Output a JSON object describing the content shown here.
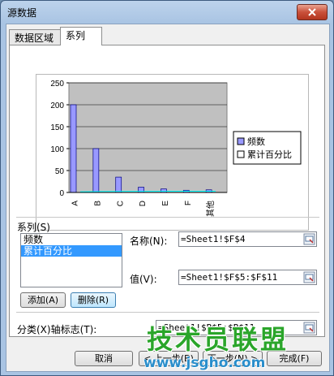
{
  "window": {
    "title": "源数据"
  },
  "tabs": [
    {
      "label": "数据区域"
    },
    {
      "label": "系列"
    }
  ],
  "series_section": {
    "label": "系列(S)",
    "items": [
      "频数",
      "累计百分比"
    ],
    "selected_index": 1,
    "add_button": "添加(A)",
    "delete_button": "删除(R)"
  },
  "fields": {
    "name_label": "名称(N):",
    "name_value": "=Sheet1!$F$4",
    "value_label": "值(V):",
    "value_value": "=Sheet1!$F$5:$F$11",
    "category_label": "分类(X)轴标志(T):",
    "category_value": "=Sheet1!$B$5:$B$11"
  },
  "buttons": {
    "cancel": "取消",
    "back": "< 上一步(B)",
    "next": "下一步(N) >",
    "finish": "完成(F)"
  },
  "watermark": {
    "title": "技术员联盟",
    "url": "www.jsgho.com"
  },
  "colors": {
    "bar_fill": "#9999ff",
    "plot_bg": "#c0c0c0",
    "line_color": "#00ffff"
  },
  "chart_data": {
    "type": "bar",
    "categories": [
      "A",
      "B",
      "C",
      "D",
      "E",
      "F",
      "其他"
    ],
    "series": [
      {
        "name": "频数",
        "values": [
          200,
          100,
          35,
          12,
          8,
          5,
          6
        ]
      },
      {
        "name": "累计百分比",
        "values": [
          0.55,
          0.82,
          0.92,
          0.95,
          0.97,
          0.98,
          1.0
        ]
      }
    ],
    "yticks": [
      "0",
      "50",
      "100",
      "150",
      "200",
      "250"
    ],
    "ylim": [
      0,
      250
    ],
    "grid": true,
    "legend": "right"
  }
}
